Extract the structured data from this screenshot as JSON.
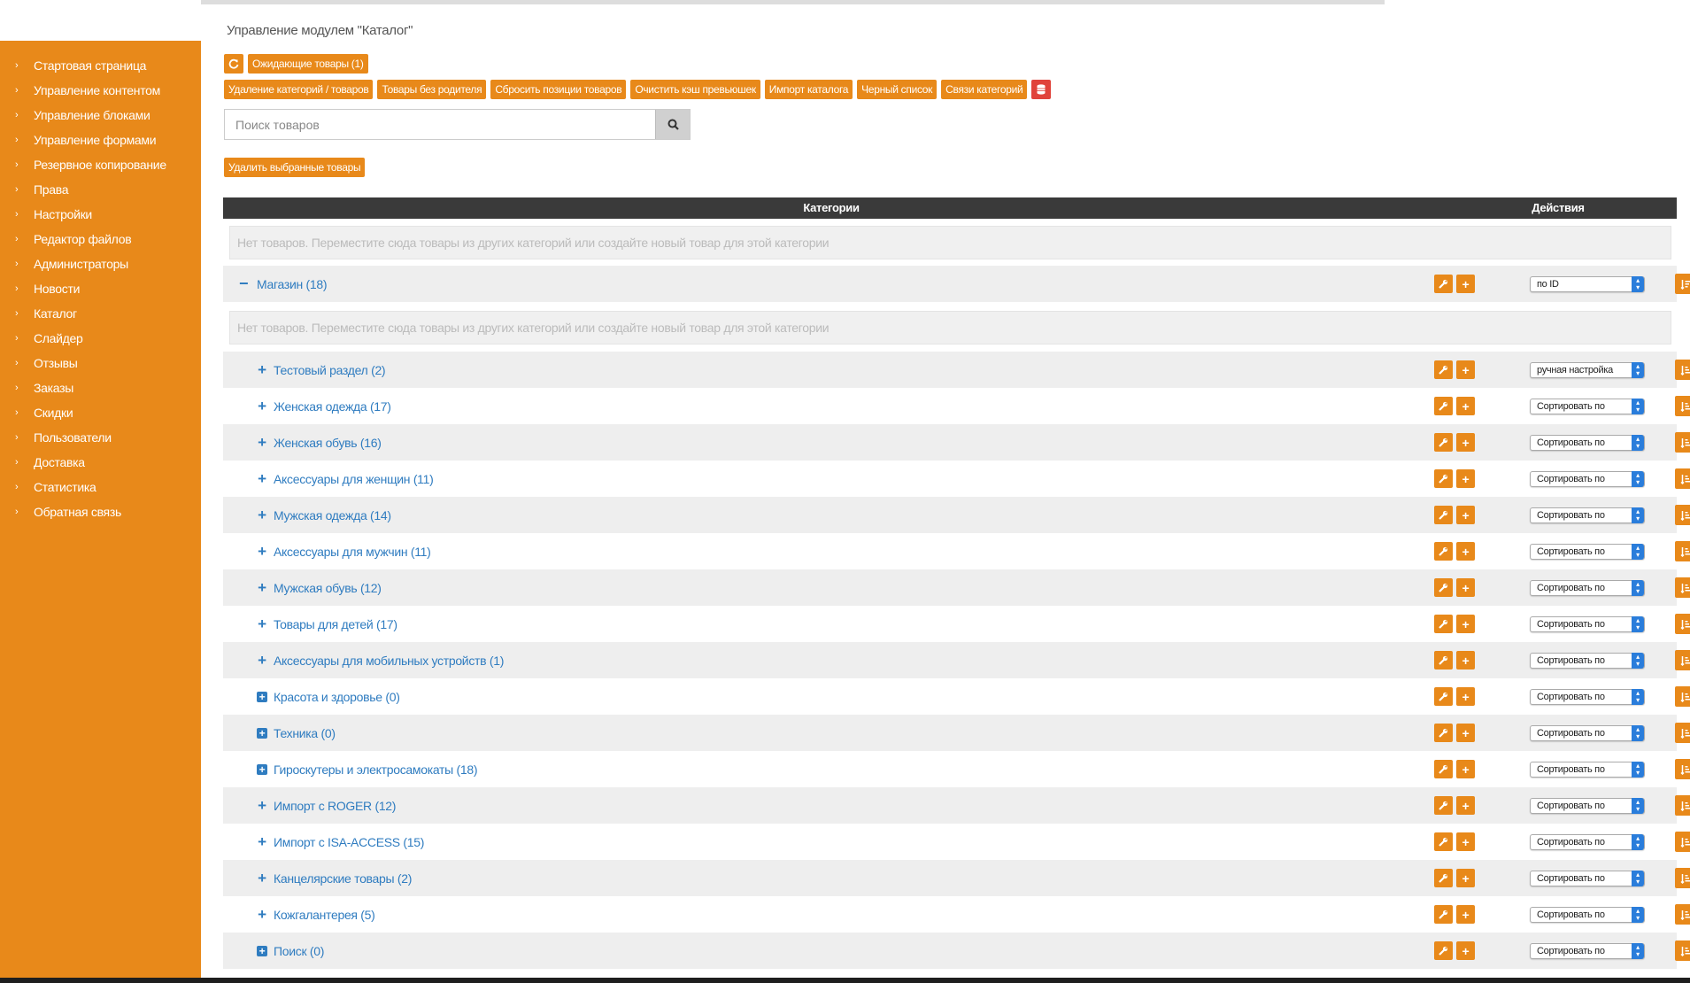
{
  "sidebar": {
    "items": [
      "Стартовая страница",
      "Управление контентом",
      "Управление блоками",
      "Управление формами",
      "Резервное копирование",
      "Права",
      "Настройки",
      "Редактор файлов",
      "Администраторы",
      "Новости",
      "Каталог",
      "Слайдер",
      "Отзывы",
      "Заказы",
      "Скидки",
      "Пользователи",
      "Доставка",
      "Статистика",
      "Обратная связь"
    ]
  },
  "page_title": "Управление модулем \"Каталог\"",
  "toolbar1": {
    "pending": "Ожидающие товары (1)"
  },
  "toolbar2": [
    "Удаление категорий / товаров",
    "Товары без родителя",
    "Сбросить позиции товаров",
    "Очистить кэш превьюшек",
    "Импорт каталога",
    "Черный список",
    "Связи категорий"
  ],
  "search": {
    "placeholder": "Поиск товаров"
  },
  "delete_selected": "Удалить выбранные товары",
  "table": {
    "col_categories": "Категории",
    "col_actions": "Действия"
  },
  "empty_text": "Нет товаров. Переместите сюда товары из других категорий или создайте новый товар для этой категории",
  "root": {
    "name": "Магазин (18)",
    "sort": "по ID"
  },
  "categories": [
    {
      "name": "Тестовый раздел (2)",
      "sort": "ручная настройка",
      "box": false
    },
    {
      "name": "Женская одежда (17)",
      "sort": "Сортировать по",
      "box": false
    },
    {
      "name": "Женская обувь (16)",
      "sort": "Сортировать по",
      "box": false
    },
    {
      "name": "Аксессуары для женщин (11)",
      "sort": "Сортировать по",
      "box": false
    },
    {
      "name": "Мужская одежда (14)",
      "sort": "Сортировать по",
      "box": false
    },
    {
      "name": "Аксессуары для мужчин (11)",
      "sort": "Сортировать по",
      "box": false
    },
    {
      "name": "Мужская обувь (12)",
      "sort": "Сортировать по",
      "box": false
    },
    {
      "name": "Товары для детей (17)",
      "sort": "Сортировать по",
      "box": false
    },
    {
      "name": "Аксессуары для мобильных устройств (1)",
      "sort": "Сортировать по",
      "box": false
    },
    {
      "name": "Красота и здоровье (0)",
      "sort": "Сортировать по",
      "box": true
    },
    {
      "name": "Техника (0)",
      "sort": "Сортировать по",
      "box": true
    },
    {
      "name": "Гироскутеры и электросамокаты (18)",
      "sort": "Сортировать по",
      "box": true
    },
    {
      "name": "Импорт с ROGER (12)",
      "sort": "Сортировать по",
      "box": false
    },
    {
      "name": "Импорт с ISA-ACCESS (15)",
      "sort": "Сортировать по",
      "box": false
    },
    {
      "name": "Канцелярские товары (2)",
      "sort": "Сортировать по",
      "box": false
    },
    {
      "name": "Кожгалантерея (5)",
      "sort": "Сортировать по",
      "box": false
    },
    {
      "name": "Поиск (0)",
      "sort": "Сортировать по",
      "box": true
    }
  ],
  "colors": {
    "accent": "#e8891a",
    "link": "#2f7cc0",
    "danger": "#e0433b",
    "header": "#3a3a3a"
  }
}
